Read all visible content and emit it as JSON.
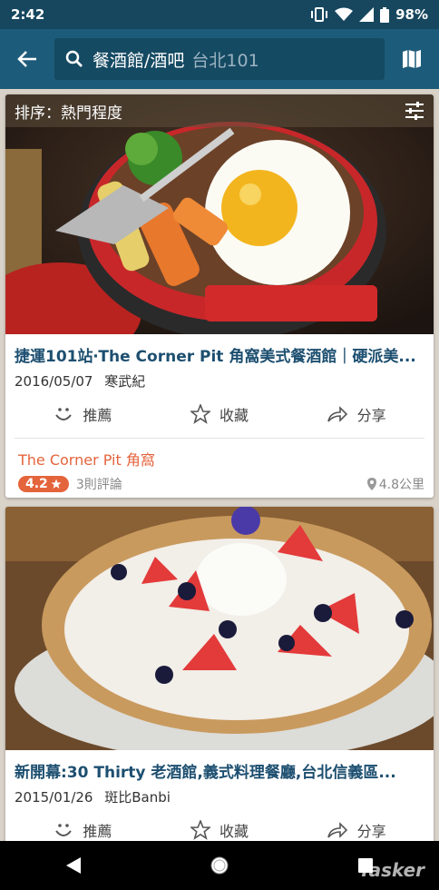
{
  "status_bar": {
    "time": "2:42",
    "battery": "98%"
  },
  "app_bar": {
    "search_query": "餐酒館/酒吧",
    "search_location": "台北101",
    "icons": {
      "back": "arrow-left-icon",
      "search": "search-icon",
      "map": "map-icon"
    }
  },
  "sort": {
    "label": "排序：熱門程度",
    "icon": "tune-icon"
  },
  "actions": {
    "recommend": "推薦",
    "save": "收藏",
    "share": "分享"
  },
  "cards": [
    {
      "title": "捷運101站‧The Corner Pit 角窩美式餐酒館｜硬派美...",
      "date": "2016/05/07",
      "author": "寒武紀",
      "place_name": "The Corner Pit 角窩",
      "rating": "4.2",
      "reviews": "3則評論",
      "distance": "4.8公里"
    },
    {
      "title": "新開幕:30 Thirty 老酒館,義式料理餐廳,台北信義區...",
      "date": "2015/01/26",
      "author": "斑比Banbi"
    }
  ],
  "watermark": "Tasker",
  "colors": {
    "status_bar": "#17475f",
    "app_bar": "#1d5b7a",
    "title": "#1d4f70",
    "accent": "#e4643c"
  }
}
